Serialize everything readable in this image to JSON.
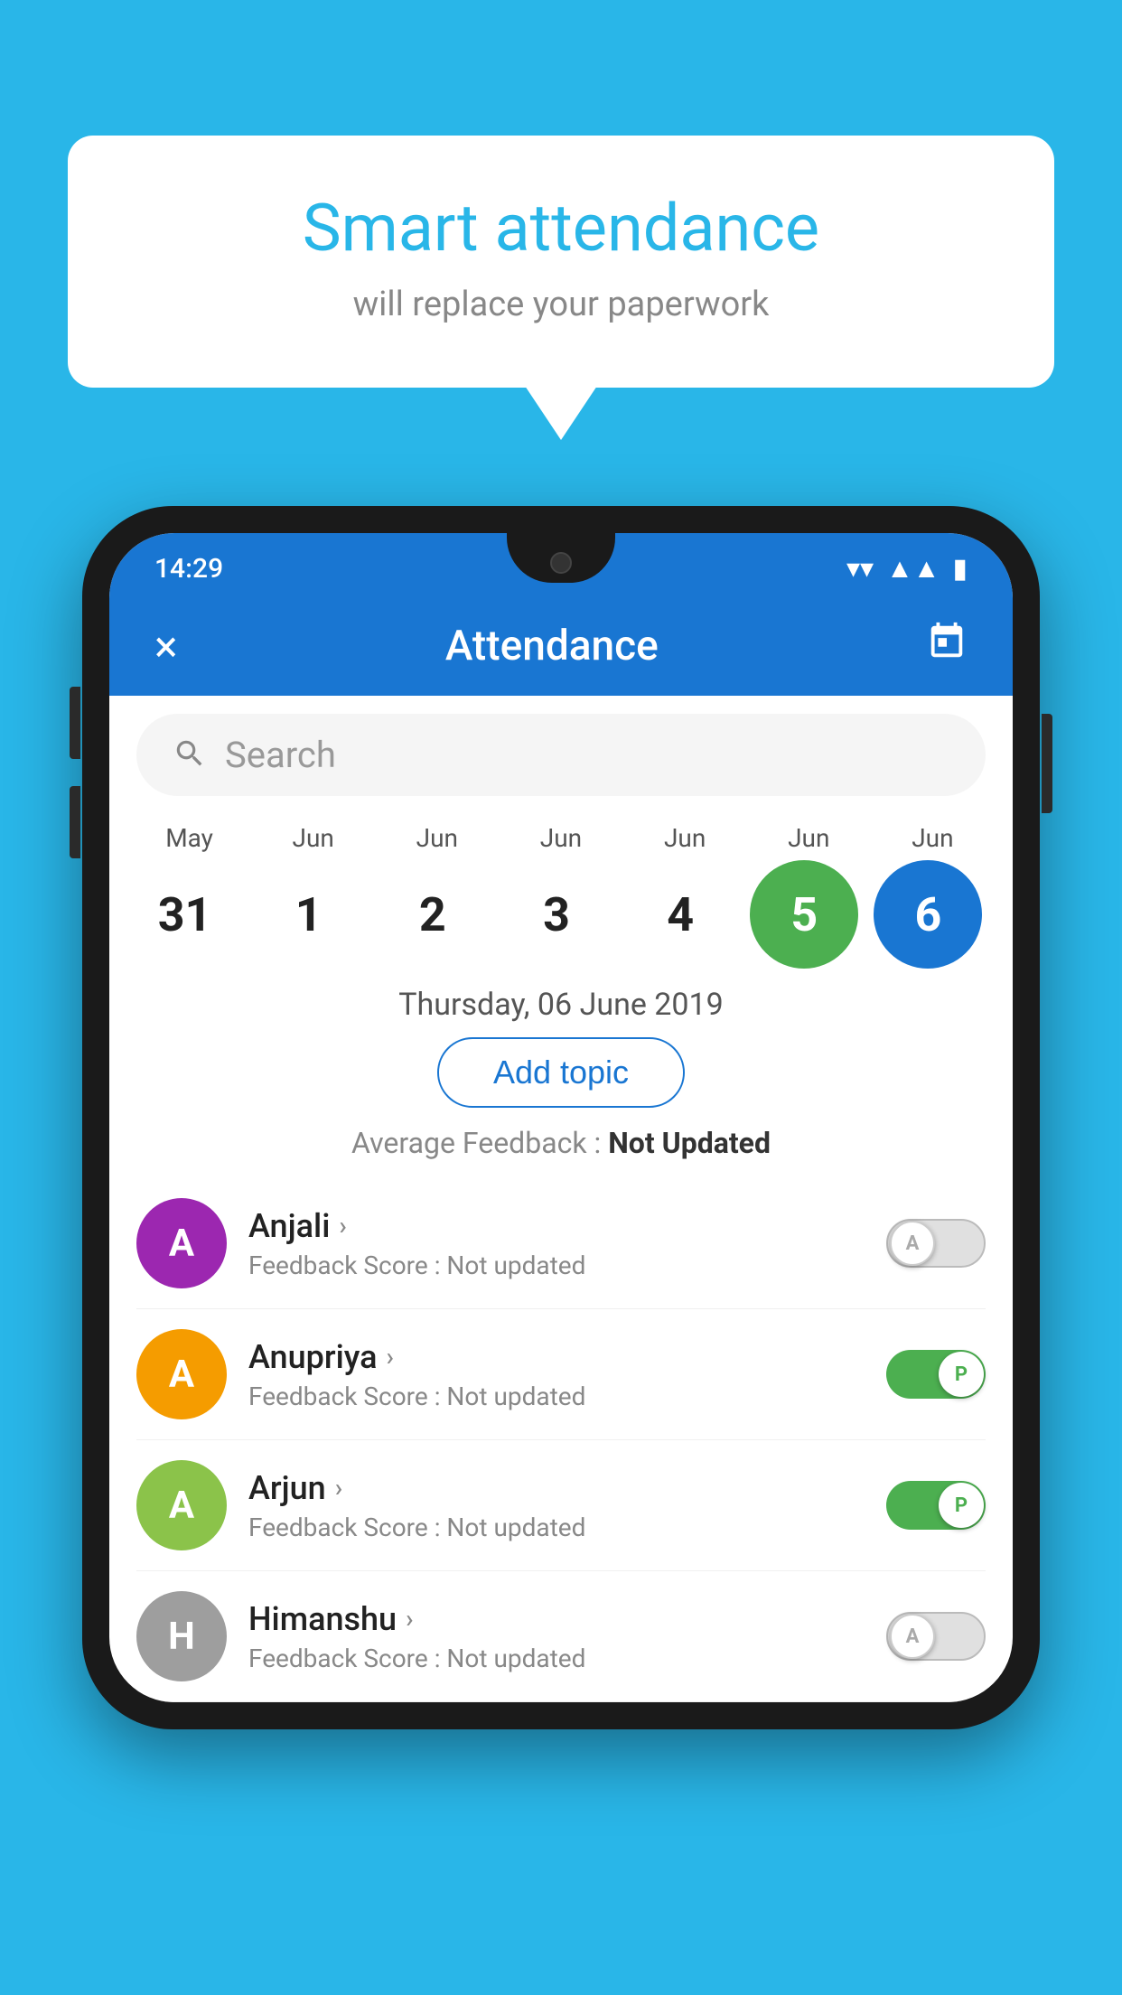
{
  "background_color": "#29b6e8",
  "speech_bubble": {
    "title": "Smart attendance",
    "subtitle": "will replace your paperwork"
  },
  "status_bar": {
    "time": "14:29",
    "wifi": "▼",
    "signal": "▲",
    "battery": "▮"
  },
  "app_bar": {
    "title": "Attendance",
    "close_label": "×",
    "calendar_label": "📅"
  },
  "search": {
    "placeholder": "Search"
  },
  "calendar": {
    "days": [
      {
        "month": "May",
        "date": "31",
        "style": "normal"
      },
      {
        "month": "Jun",
        "date": "1",
        "style": "normal"
      },
      {
        "month": "Jun",
        "date": "2",
        "style": "normal"
      },
      {
        "month": "Jun",
        "date": "3",
        "style": "normal"
      },
      {
        "month": "Jun",
        "date": "4",
        "style": "normal"
      },
      {
        "month": "Jun",
        "date": "5",
        "style": "today"
      },
      {
        "month": "Jun",
        "date": "6",
        "style": "selected"
      }
    ],
    "selected_date": "Thursday, 06 June 2019"
  },
  "add_topic": {
    "label": "Add topic"
  },
  "avg_feedback": {
    "label": "Average Feedback : ",
    "value": "Not Updated"
  },
  "students": [
    {
      "name": "Anjali",
      "avatar_letter": "A",
      "avatar_color": "#9c27b0",
      "feedback_label": "Feedback Score : ",
      "feedback_value": "Not updated",
      "toggle_state": "off",
      "toggle_letter": "A"
    },
    {
      "name": "Anupriya",
      "avatar_letter": "A",
      "avatar_color": "#f59c00",
      "feedback_label": "Feedback Score : ",
      "feedback_value": "Not updated",
      "toggle_state": "on",
      "toggle_letter": "P"
    },
    {
      "name": "Arjun",
      "avatar_letter": "A",
      "avatar_color": "#8bc34a",
      "feedback_label": "Feedback Score : ",
      "feedback_value": "Not updated",
      "toggle_state": "on",
      "toggle_letter": "P"
    },
    {
      "name": "Himanshu",
      "avatar_letter": "H",
      "avatar_color": "#9e9e9e",
      "feedback_label": "Feedback Score : ",
      "feedback_value": "Not updated",
      "toggle_state": "off",
      "toggle_letter": "A"
    }
  ]
}
